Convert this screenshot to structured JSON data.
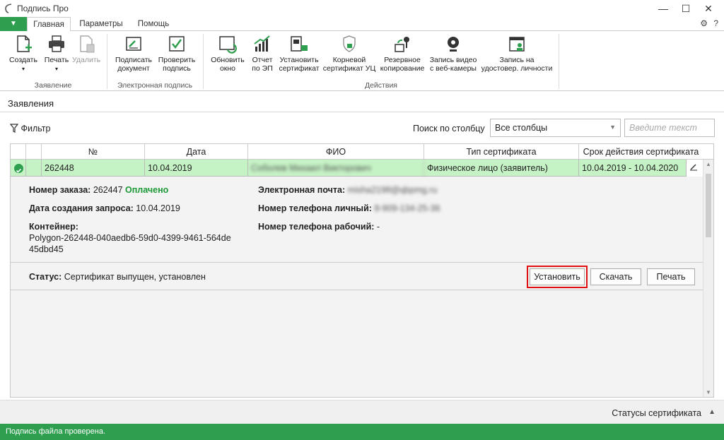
{
  "window": {
    "title": "Подпись Про",
    "minimize": "—",
    "maximize": "☐",
    "close": "✕"
  },
  "tabs": {
    "file_arrow": "▼",
    "items": [
      "Главная",
      "Параметры",
      "Помощь"
    ],
    "settings_icon": "⚙",
    "help_icon": "?"
  },
  "ribbon": {
    "create": "Создать",
    "print": "Печать",
    "delete": "Удалить",
    "group1": "Заявление",
    "sign_doc": [
      "Подписать",
      "документ"
    ],
    "verify_sign": [
      "Проверить",
      "подпись"
    ],
    "group2": "Электронная подпись",
    "refresh": [
      "Обновить",
      "окно"
    ],
    "report": [
      "Отчет",
      "по ЭП"
    ],
    "install_cert": [
      "Установить",
      "сертификат"
    ],
    "root_cert": [
      "Корневой",
      "сертификат УЦ"
    ],
    "backup": [
      "Резервное",
      "копирование"
    ],
    "webcam": [
      "Запись видео",
      "с веб-камеры"
    ],
    "id_record": [
      "Запись на",
      "удостовер. личности"
    ],
    "group3": "Действия"
  },
  "section": {
    "title": "Заявления"
  },
  "toolbar": {
    "filter": "Фильтр",
    "search_label": "Поиск по столбцу",
    "column_select": "Все столбцы",
    "search_placeholder": "Введите текст"
  },
  "grid": {
    "headers": [
      "№",
      "Дата",
      "ФИО",
      "Тип сертификата",
      "Срок действия сертификата"
    ],
    "row": {
      "number": "262448",
      "date": "10.04.2019",
      "fio": "Соболев Михаил Викторович",
      "type": "Физическое лицо (заявитель)",
      "validity": "10.04.2019 - 10.04.2020"
    }
  },
  "detail": {
    "order_label": "Номер заказа:",
    "order_value": "262447",
    "order_status": "Оплачено",
    "created_label": "Дата создания запроса:",
    "created_value": "10.04.2019",
    "container_label": "Контейнер:",
    "container_line1": "Polygon-262448-040aedb6-59d0-4399-9461-564de",
    "container_line2": "45dbd45",
    "email_label": "Электронная почта:",
    "email_value": "misha2198@qbpmg.ru",
    "phone_personal_label": "Номер телефона личный:",
    "phone_personal_value": "8-909-134-25-36",
    "phone_work_label": "Номер телефона рабочий:",
    "phone_work_value": "-",
    "status_label": "Статус:",
    "status_value": "Сертификат выпущен, установлен",
    "install_btn": "Установить",
    "download_btn": "Скачать",
    "print_btn": "Печать"
  },
  "bottom": {
    "cert_statuses": "Статусы сертификата",
    "status_message": "Подпись файла проверена."
  },
  "colors": {
    "accent": "#2e9e4f",
    "row_selected": "#c6f3c6",
    "paid": "#1d9a37",
    "highlight": "#e01010"
  }
}
